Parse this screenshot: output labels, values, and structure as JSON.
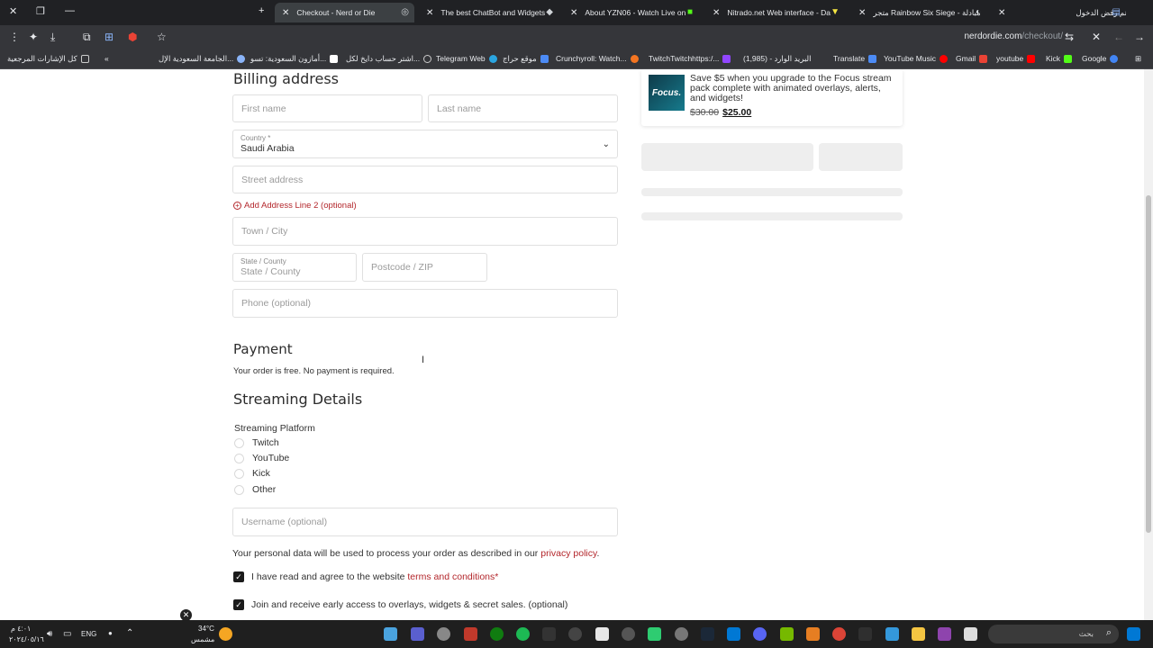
{
  "browser": {
    "tabs": [
      {
        "title": "Checkout - Nerd or Die",
        "active": true
      },
      {
        "title": "The best ChatBot and Widgets"
      },
      {
        "title": "About YZN06 - Watch Live on"
      },
      {
        "title": "Nitrado.net Web interface - Da"
      },
      {
        "title": "متجر Rainbow Six Siege - مبادلة"
      },
      {
        "title": "تم رفض الدخول"
      }
    ],
    "url_host": "nerdordie.com",
    "url_path": "/checkout/",
    "bookmarks": [
      "Google",
      "Kick",
      "youtube",
      "Gmail",
      "YouTube Music",
      "Translate",
      "البريد الوارد - (1,985)",
      "TwitchTwitchhttps:/...",
      "Crunchyroll: Watch...",
      "موقع حراج",
      "Telegram Web",
      "اشتر حساب دايخ لكل...",
      "أمازون السعودية: تسو...",
      "الجامعة السعودية الإل...",
      "كل الإشارات المرجعية"
    ]
  },
  "billing": {
    "heading": "Billing address",
    "first_name_placeholder": "First name",
    "last_name_placeholder": "Last name",
    "country_label": "Country *",
    "country_value": "Saudi Arabia",
    "street_placeholder": "Street address",
    "add_line2": "Add Address Line 2 (optional)",
    "town_placeholder": "Town / City",
    "state_label": "State / County",
    "state_placeholder": "State / County",
    "postcode_placeholder": "Postcode / ZIP",
    "phone_placeholder": "Phone (optional)"
  },
  "payment": {
    "heading": "Payment",
    "note": "Your order is free. No payment is required."
  },
  "streaming": {
    "heading": "Streaming Details",
    "platform_label": "Streaming Platform",
    "options": [
      "Twitch",
      "YouTube",
      "Kick",
      "Other"
    ],
    "username_placeholder": "Username (optional)"
  },
  "legal": {
    "privacy_prefix": "Your personal data will be used to process your order as described in our ",
    "privacy_link": "privacy policy",
    "privacy_suffix": ".",
    "terms_prefix": "I have read and agree to the website ",
    "terms_link": "terms and conditions",
    "terms_suffix": "*",
    "newsletter": "Join and receive early access to overlays, widgets & secret sales. (optional)"
  },
  "promo": {
    "thumb_text": "Focus.",
    "description": "Save $5 when you upgrade to the Focus stream pack complete with animated overlays, alerts, and widgets!",
    "old_price": "$30.00",
    "new_price": "$25.00"
  },
  "taskbar": {
    "weather_temp": "34°C",
    "weather_desc": "مشمس",
    "lang": "ENG",
    "time": "٤:٠١ م",
    "date": "٢٠٢٤/٠٥/١٦",
    "search": "بحث"
  }
}
